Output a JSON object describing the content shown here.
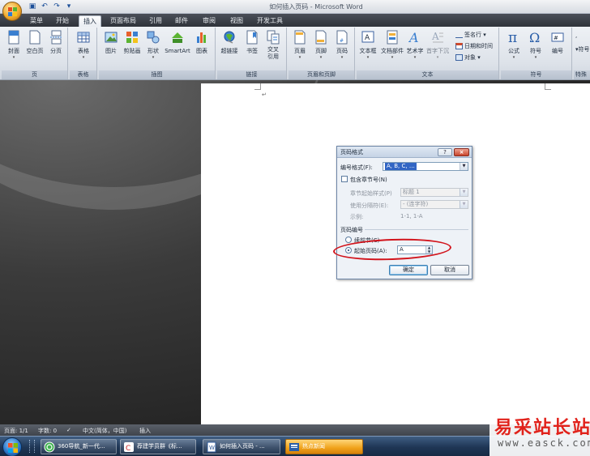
{
  "window": {
    "title": "如何插入页码 - Microsoft Word",
    "quick_access": [
      "save-icon",
      "undo-icon",
      "redo-icon",
      "customize-icon"
    ]
  },
  "tabs": [
    "菜单",
    "开始",
    "插入",
    "页面布局",
    "引用",
    "邮件",
    "审阅",
    "视图",
    "开发工具"
  ],
  "active_tab": "插入",
  "ribbon": {
    "groups": {
      "page": {
        "label": "页",
        "buttons": [
          "封面",
          "空白页",
          "分页"
        ]
      },
      "table": {
        "label": "表格",
        "buttons": [
          "表格"
        ]
      },
      "illustrations": {
        "label": "插图",
        "buttons": [
          "图片",
          "剪贴画",
          "形状",
          "SmartArt",
          "图表"
        ]
      },
      "links": {
        "label": "链接",
        "buttons": [
          "超链接",
          "书签",
          "交叉",
          "引用"
        ]
      },
      "header_footer": {
        "label": "页眉和页脚",
        "buttons": [
          "页眉",
          "页脚",
          "页码"
        ]
      },
      "text": {
        "label": "文本",
        "buttons": [
          "文本框",
          "文档部件",
          "艺术字",
          "首字下沉"
        ],
        "small": [
          "签名行",
          "日期和时间",
          "对象"
        ]
      },
      "symbols": {
        "label": "符号",
        "buttons": [
          "公式",
          "符号",
          "编号"
        ]
      },
      "special": {
        "label": "特殊",
        "small": [
          "符号"
        ]
      }
    }
  },
  "document": {
    "paragraph_mark": "↵"
  },
  "dialog": {
    "title": "页码格式",
    "help": "?",
    "close": "×",
    "number_format_label": "编号格式(F):",
    "number_format_value": "A, B, C, …",
    "include_chapter_label": "包含章节号(N)",
    "chapter_style_label": "章节起始样式(P)",
    "chapter_style_value": "标题 1",
    "separator_label": "使用分隔符(E):",
    "separator_value": "-  (连字符)",
    "example_label": "示例:",
    "example_value": "1-1, 1-A",
    "numbering_section": "页码编号",
    "continue_label": "续前节(C)",
    "start_at_label": "起始页码(A):",
    "start_at_value": "A",
    "ok": "确定",
    "cancel": "取消"
  },
  "statusbar": {
    "page": "页面: 1/1",
    "words": "字数: 0",
    "language": "中文(简体，中国)",
    "mode": "插入"
  },
  "taskbar": {
    "items": [
      "360导航_新一代...",
      "荐建学员群《标...",
      "如何插入页码 - ...",
      "热点新闻"
    ]
  },
  "watermark": {
    "line1": "易采站长站",
    "line2": "www.easck.com"
  },
  "colors": {
    "accent_blue": "#3165c4",
    "annotation_red": "#d2141c",
    "taskbar_highlight": "#f0a21a"
  }
}
